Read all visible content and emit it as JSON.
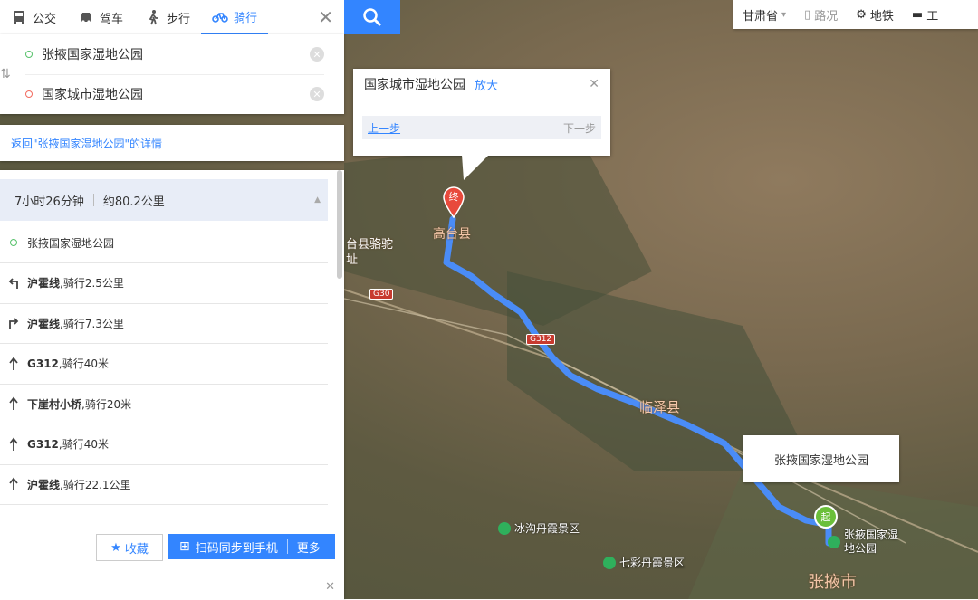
{
  "modes": {
    "bus": "公交",
    "car": "驾车",
    "walk": "步行",
    "bike": "骑行"
  },
  "route": {
    "start": "张掖国家湿地公园",
    "end": "国家城市湿地公园"
  },
  "back_link": "返回\"张掖国家湿地公园\"的详情",
  "summary": {
    "time": "7小时26分钟",
    "distance": "约80.2公里"
  },
  "steps": [
    {
      "road": "",
      "text": "张掖国家湿地公园",
      "icon": "start-dot-icon"
    },
    {
      "road": "沪霍线",
      "text": ",骑行2.5公里",
      "icon": "turn-left-icon"
    },
    {
      "road": "沪霍线",
      "text": ",骑行7.3公里",
      "icon": "turn-right-icon"
    },
    {
      "road": "G312",
      "text": ",骑行40米",
      "icon": "straight-icon"
    },
    {
      "road": "下崖村小桥",
      "text": ",骑行20米",
      "icon": "straight-icon"
    },
    {
      "road": "G312",
      "text": ",骑行40米",
      "icon": "straight-icon"
    },
    {
      "road": "沪霍线",
      "text": ",骑行22.1公里",
      "icon": "straight-icon"
    }
  ],
  "actions": {
    "fav": "收藏",
    "sync": "扫码同步到手机",
    "more": "更多"
  },
  "topright": {
    "province": "甘肃省",
    "traffic": "路况",
    "subway": "地铁",
    "tools": "工"
  },
  "popup": {
    "title": "国家城市湿地公园",
    "zoom": "放大",
    "prev": "上一步",
    "next": "下一步"
  },
  "start_label": "张掖国家湿地公园",
  "map_labels": {
    "gaotai": "高台县",
    "linze": "临泽县",
    "zhangye": "张掖市",
    "luotuo": "台县骆驼",
    "zhi": "址",
    "poi1": "冰沟丹霞景区",
    "poi2": "七彩丹霞景区",
    "poi3": "张掖国家湿地公园",
    "g30": "G30",
    "g312": "G312",
    "end_marker": "终",
    "start_marker": "起"
  },
  "colors": {
    "accent": "#3385ff",
    "route": "#4a8cf7"
  }
}
